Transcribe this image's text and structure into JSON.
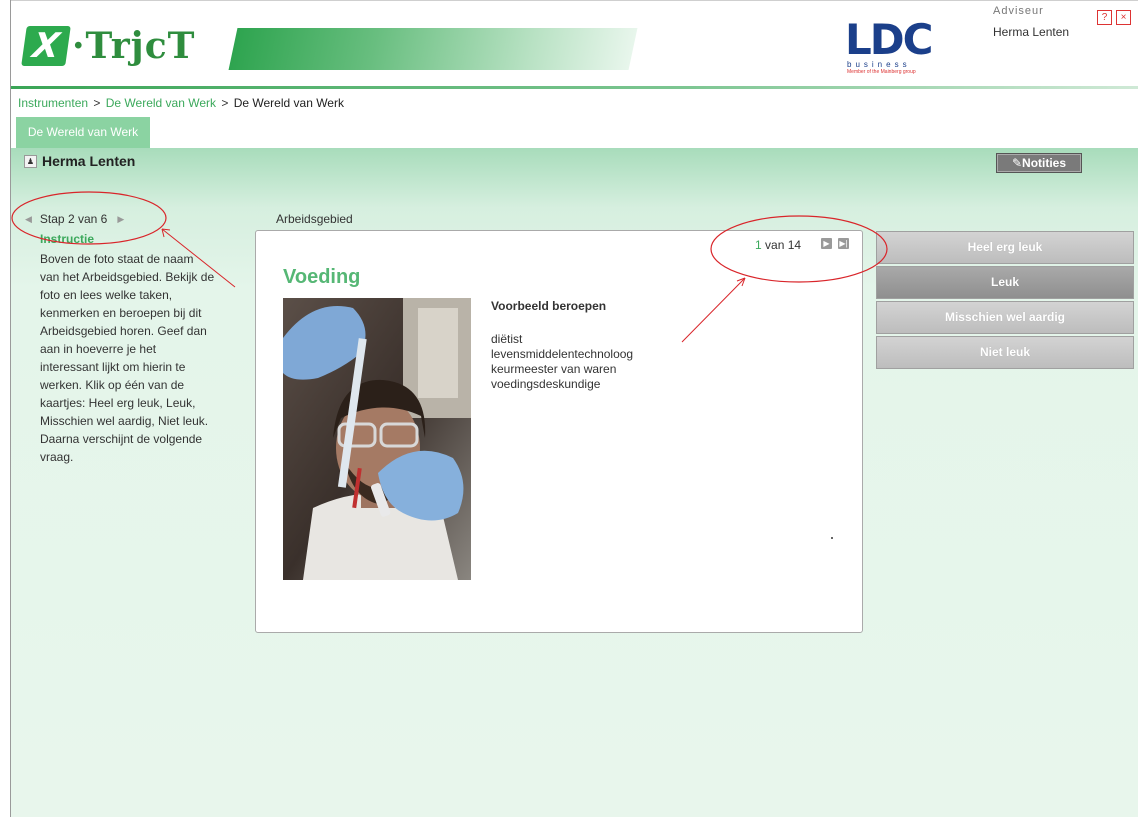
{
  "header": {
    "logo_letter": "X",
    "logo_text": "·TrjcT",
    "ldc_letters": "LDC",
    "ldc_tagline": "business",
    "ldc_member": "Member of the Mainberg group",
    "adviseur_label": "Adviseur",
    "adviseur_name": "Herma Lenten",
    "help_icon": "?",
    "close_icon": "×"
  },
  "breadcrumb": {
    "items": [
      "Instrumenten",
      "De Wereld van Werk",
      "De Wereld van Werk"
    ],
    "separator": ">"
  },
  "tab": {
    "label": "De Wereld van Werk"
  },
  "user": {
    "name": "Herma Lenten"
  },
  "notities": {
    "label": "✎Notities"
  },
  "step": {
    "label": "Stap 2 van 6"
  },
  "instructie": {
    "title": "Instructie",
    "body": "Boven de foto staat de naam van het Arbeidsgebied. Bekijk de foto en lees welke taken, kenmerken en beroepen bij dit Arbeidsgebied horen. Geef dan aan in hoeverre je het interessant lijkt om hierin te werken. Klik op één van de kaartjes: Heel erg leuk, Leuk, Misschien wel aardig, Niet leuk. Daarna verschijnt de volgende vraag."
  },
  "card": {
    "section_label": "Arbeidsgebied",
    "counter_current": "1",
    "counter_rest": " van 14",
    "title": "Voeding",
    "beroepen_title": "Voorbeeld beroepen",
    "beroepen": [
      "diëtist",
      "levensmiddelentechnoloog",
      "keurmeester van waren",
      "voedingsdeskundige"
    ]
  },
  "answers": [
    {
      "label": "Heel erg leuk",
      "selected": false
    },
    {
      "label": "Leuk",
      "selected": true
    },
    {
      "label": "Misschien wel aardig",
      "selected": false
    },
    {
      "label": "Niet leuk",
      "selected": false
    }
  ],
  "colors": {
    "accent_green": "#3ca95c",
    "title_green": "#56b775",
    "tab_green": "#8bd3a2",
    "annotation_red": "#d9252a",
    "ldc_blue": "#1b3f8a"
  }
}
